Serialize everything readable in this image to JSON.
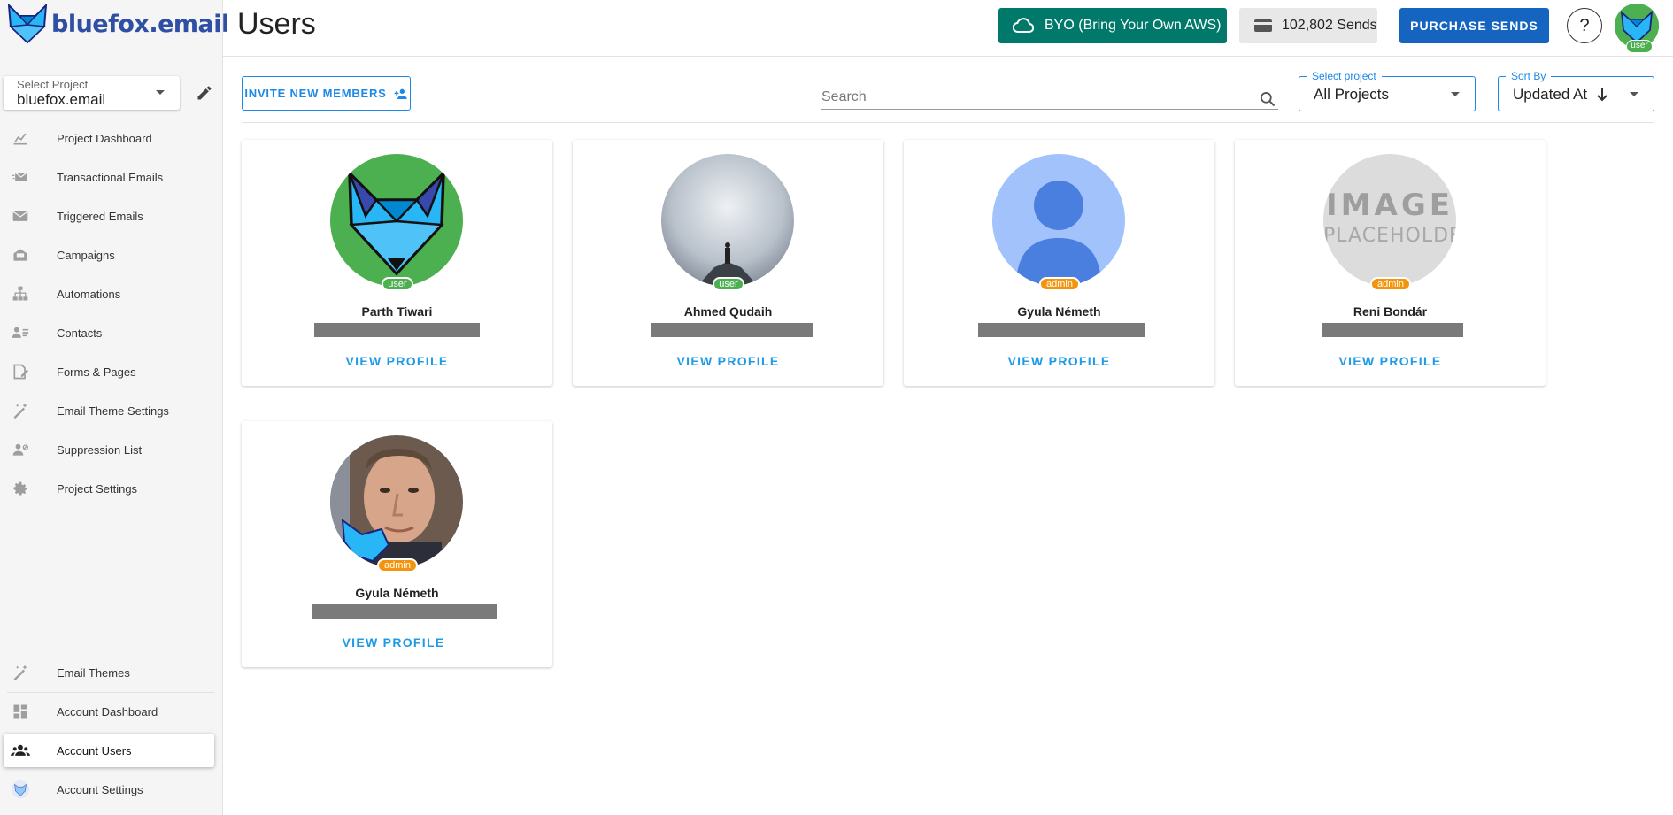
{
  "brand": {
    "logo_text": "bluefox.email"
  },
  "sidebar": {
    "project_select": {
      "label": "Select Project",
      "value": "bluefox.email"
    },
    "project_items": [
      {
        "label": "Project Dashboard",
        "icon": "chart-icon"
      },
      {
        "label": "Transactional Emails",
        "icon": "send-email-icon"
      },
      {
        "label": "Triggered Emails",
        "icon": "mail-icon"
      },
      {
        "label": "Campaigns",
        "icon": "campaign-icon"
      },
      {
        "label": "Automations",
        "icon": "sitemap-icon"
      },
      {
        "label": "Contacts",
        "icon": "contacts-icon"
      },
      {
        "label": "Forms & Pages",
        "icon": "form-icon"
      },
      {
        "label": "Email Theme Settings",
        "icon": "magic-wand-icon"
      },
      {
        "label": "Suppression List",
        "icon": "block-users-icon"
      },
      {
        "label": "Project Settings",
        "icon": "gear-icon"
      }
    ],
    "account_items": [
      {
        "label": "Email Themes",
        "icon": "magic-wand-icon"
      },
      {
        "label": "Account Dashboard",
        "icon": "dashboard-icon"
      },
      {
        "label": "Account Users",
        "icon": "group-icon",
        "active": true
      },
      {
        "label": "Account Settings",
        "icon": "account-logo-icon"
      }
    ]
  },
  "header": {
    "title": "Users",
    "byo_label": "BYO (Bring Your Own AWS)",
    "sends_label": "102,802 Sends",
    "purchase_label": "PURCHASE SENDS",
    "help_label": "?",
    "avatar_role": "user"
  },
  "toolbar": {
    "invite_label": "INVITE NEW MEMBERS",
    "search_placeholder": "Search",
    "project_filter": {
      "label": "Select project",
      "value": "All Projects"
    },
    "sort": {
      "label": "Sort By",
      "value": "Updated At"
    }
  },
  "users": [
    {
      "name": "Parth Tiwari",
      "role": "user",
      "avatar": "bluefox-logo",
      "action": "VIEW PROFILE"
    },
    {
      "name": "Ahmed Qudaih",
      "role": "user",
      "avatar": "mountain-photo",
      "action": "VIEW PROFILE"
    },
    {
      "name": "Gyula Németh",
      "role": "admin",
      "avatar": "default-person",
      "action": "VIEW PROFILE"
    },
    {
      "name": "Reni Bondár",
      "role": "admin",
      "avatar": "image-placeholder",
      "action": "VIEW PROFILE",
      "placeholder_line1": "IMAGE",
      "placeholder_line2": "PLACEHOLDER"
    },
    {
      "name": "Gyula Németh",
      "role": "admin",
      "avatar": "face-photo",
      "action": "VIEW PROFILE"
    }
  ],
  "colors": {
    "primary": "#1e88e5",
    "byo": "#00796b",
    "purchase": "#1565c0",
    "user_badge": "#4caf50",
    "admin_badge": "#f4940c"
  }
}
